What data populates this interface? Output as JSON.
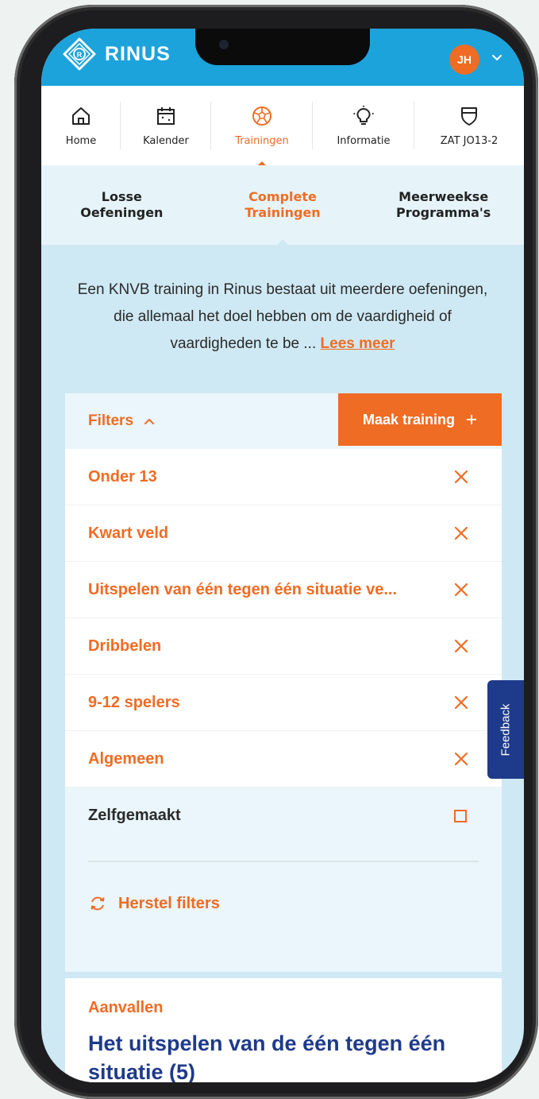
{
  "app": {
    "name": "RINUS",
    "user_initials": "JH"
  },
  "colors": {
    "accent": "#ef6c24",
    "brand_blue": "#1ca3dc",
    "navy": "#1e3a8a",
    "panel": "#cfe9f4"
  },
  "tabs": [
    {
      "label": "Home",
      "icon": "home-icon",
      "active": false
    },
    {
      "label": "Kalender",
      "icon": "calendar-icon",
      "active": false
    },
    {
      "label": "Trainingen",
      "icon": "football-icon",
      "active": true
    },
    {
      "label": "Informatie",
      "icon": "lightbulb-icon",
      "active": false
    },
    {
      "label": "ZAT JO13-2",
      "icon": "shield-icon",
      "active": false
    }
  ],
  "subtabs": [
    {
      "line1": "Losse",
      "line2": "Oefeningen",
      "active": false
    },
    {
      "line1": "Complete",
      "line2": "Trainingen",
      "active": true
    },
    {
      "line1": "Meerweekse",
      "line2": "Programma's",
      "active": false
    }
  ],
  "intro": {
    "text": "Een KNVB training in Rinus bestaat uit meerdere oefeningen, die allemaal het doel hebben om de vaardigheid of vaardigheden te be",
    "ellipsis": " ...",
    "link": "Lees meer"
  },
  "filters": {
    "toggle_label": "Filters",
    "make_button": "Maak training",
    "active": [
      "Onder 13",
      "Kwart veld",
      "Uitspelen van één tegen één situatie ve...",
      "Dribbelen",
      "9-12 spelers",
      "Algemeen"
    ],
    "unchecked": "Zelfgemaakt",
    "reset": "Herstel filters"
  },
  "feedback": "Feedback",
  "result": {
    "category": "Aanvallen",
    "title": "Het uitspelen van de één tegen één situatie (5)"
  }
}
